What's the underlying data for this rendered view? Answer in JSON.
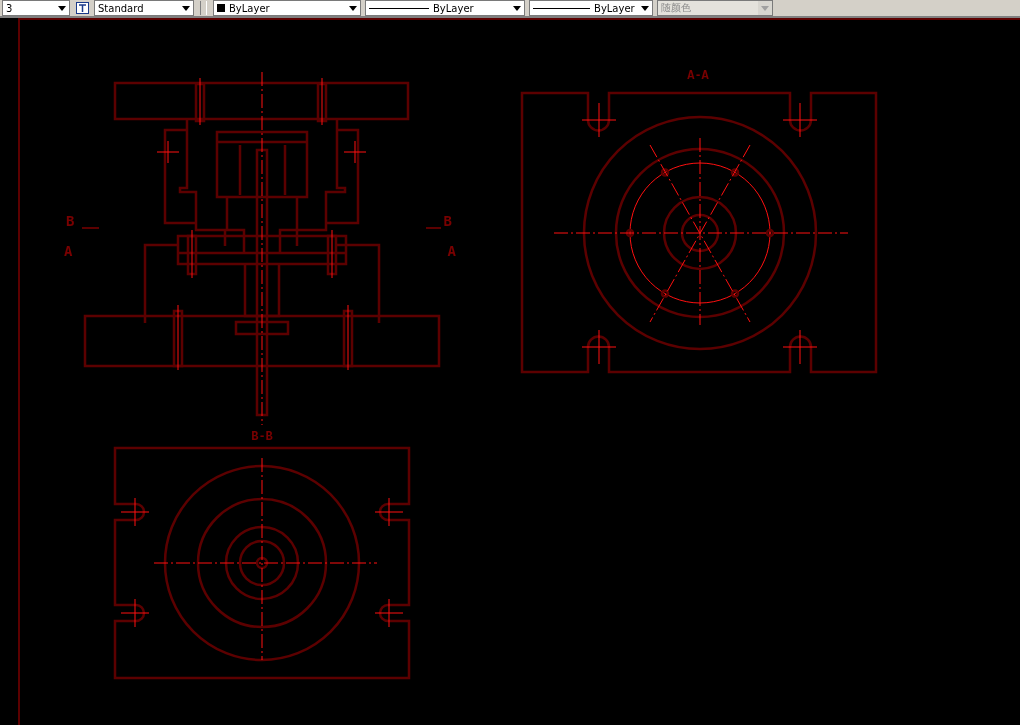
{
  "toolbar": {
    "combos": [
      {
        "kind": "plain",
        "value": "3",
        "disabled": false
      },
      {
        "kind": "textstyle",
        "value": "Standard",
        "disabled": false
      },
      {
        "kind": "color",
        "value": "ByLayer",
        "disabled": false
      },
      {
        "kind": "linetype",
        "value": "ByLayer",
        "disabled": false
      },
      {
        "kind": "lineweight",
        "value": "ByLayer",
        "disabled": false
      },
      {
        "kind": "plotstyle",
        "value": "随颜色",
        "disabled": true
      }
    ]
  },
  "drawing": {
    "labels": [
      {
        "kind": "cut",
        "text": "B"
      },
      {
        "kind": "cut",
        "text": "A"
      },
      {
        "kind": "cut",
        "text": "B"
      },
      {
        "kind": "cut",
        "text": "A"
      },
      {
        "kind": "title",
        "text": "A-A"
      },
      {
        "kind": "title",
        "text": "B-B"
      }
    ]
  }
}
